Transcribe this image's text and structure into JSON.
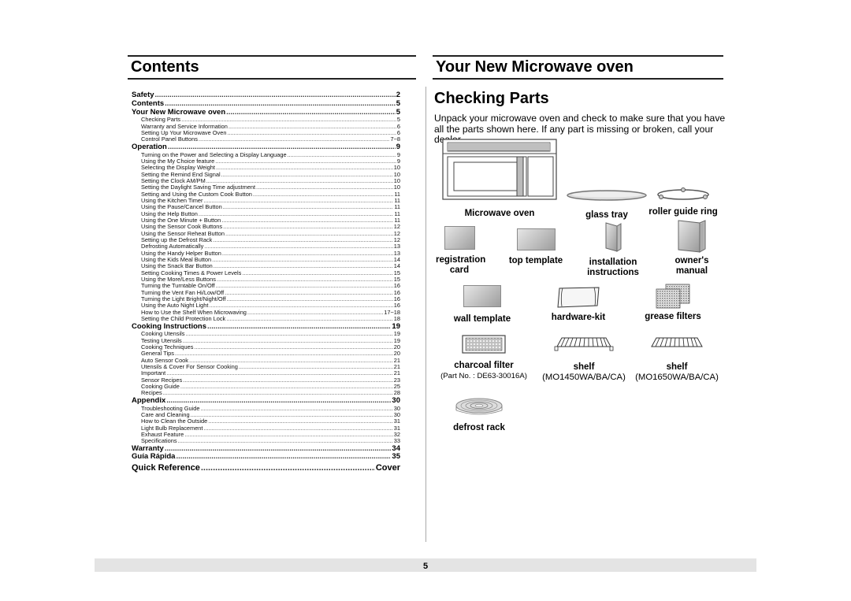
{
  "contents": {
    "title": "Contents",
    "entries": [
      {
        "level": "main",
        "label": "Safety",
        "page": "2"
      },
      {
        "level": "main",
        "label": "Contents",
        "page": "5"
      },
      {
        "level": "main",
        "label": "Your New Microwave oven",
        "page": "5"
      },
      {
        "level": "sub",
        "label": "Checking Parts",
        "page": "5"
      },
      {
        "level": "sub",
        "label": "Warranty and Service Information",
        "page": "6"
      },
      {
        "level": "sub",
        "label": "Setting Up Your Microwave Oven",
        "page": "6"
      },
      {
        "level": "sub",
        "label": "Control Panel Buttons",
        "page": "7~8"
      },
      {
        "level": "main",
        "label": "Operation",
        "page": "9"
      },
      {
        "level": "sub",
        "label": "Turning on the Power and Selecting a Display Language",
        "page": "9"
      },
      {
        "level": "sub",
        "label": "Using the My Choice feature",
        "page": "9"
      },
      {
        "level": "sub",
        "label": "Selecting the Display Weight",
        "page": "10"
      },
      {
        "level": "sub",
        "label": "Setting the Remind End Signal",
        "page": "10"
      },
      {
        "level": "sub",
        "label": "Setting the Clock AM/PM",
        "page": "10"
      },
      {
        "level": "sub",
        "label": "Setting the Daylight Saving Time adjustment",
        "page": "10"
      },
      {
        "level": "sub",
        "label": "Setting and Using the Custom Cook Button",
        "page": "11"
      },
      {
        "level": "sub",
        "label": "Using the Kitchen Timer",
        "page": "11"
      },
      {
        "level": "sub",
        "label": "Using the Pause/Cancel Button",
        "page": "11"
      },
      {
        "level": "sub",
        "label": "Using the Help Button",
        "page": "11"
      },
      {
        "level": "sub",
        "label": "Using the One Minute + Button",
        "page": "11"
      },
      {
        "level": "sub",
        "label": "Using the Sensor Cook Buttons",
        "page": "12"
      },
      {
        "level": "sub",
        "label": "Using the Sensor Reheat Button",
        "page": "12"
      },
      {
        "level": "sub",
        "label": "Setting up the Defrost Rack",
        "page": "12"
      },
      {
        "level": "sub",
        "label": "Defrosting Automatically",
        "page": "13"
      },
      {
        "level": "sub",
        "label": "Using the Handy Helper Button",
        "page": "13"
      },
      {
        "level": "sub",
        "label": "Using the Kids Meal Button",
        "page": "14"
      },
      {
        "level": "sub",
        "label": "Using the Snack Bar Button",
        "page": "14"
      },
      {
        "level": "sub",
        "label": "Setting Cooking Times & Power Levels",
        "page": "15"
      },
      {
        "level": "sub",
        "label": "Using the More/Less Buttons",
        "page": "15"
      },
      {
        "level": "sub",
        "label": "Turning the Turntable On/Off",
        "page": "16"
      },
      {
        "level": "sub",
        "label": "Turning the Vent Fan Hi/Low/Off",
        "page": "16"
      },
      {
        "level": "sub",
        "label": "Turning the  Light Bright/Night/Off",
        "page": "16"
      },
      {
        "level": "sub",
        "label": "Using the Auto Night Light",
        "page": "16"
      },
      {
        "level": "sub",
        "label": "How to Use the Shelf When Microwaving",
        "page": "17~18"
      },
      {
        "level": "sub",
        "label": "Setting the Child Protection Lock",
        "page": "18"
      },
      {
        "level": "main",
        "label": "Cooking Instructions",
        "page": "19"
      },
      {
        "level": "sub",
        "label": "Cooking Utensils",
        "page": "19"
      },
      {
        "level": "sub",
        "label": "Testing Utensils",
        "page": "19"
      },
      {
        "level": "sub",
        "label": "Cooking Techniques",
        "page": "20"
      },
      {
        "level": "sub",
        "label": "General Tips",
        "page": "20"
      },
      {
        "level": "sub",
        "label": "Auto Sensor Cook",
        "page": "21"
      },
      {
        "level": "sub",
        "label": "Utensils & Cover For Sensor Cooking",
        "page": "21"
      },
      {
        "level": "sub",
        "label": "Important",
        "page": "21"
      },
      {
        "level": "sub",
        "label": "Sensor Recipes",
        "page": "23"
      },
      {
        "level": "sub",
        "label": "Cooking Guide",
        "page": "25"
      },
      {
        "level": "sub",
        "label": "Recipes",
        "page": "28"
      },
      {
        "level": "main",
        "label": "Appendix",
        "page": "30"
      },
      {
        "level": "sub",
        "label": "Troubleshooting Guide",
        "page": "30"
      },
      {
        "level": "sub",
        "label": "Care and Cleaning",
        "page": "30"
      },
      {
        "level": "sub",
        "label": "How to Clean the Outside",
        "page": "31"
      },
      {
        "level": "sub",
        "label": "Light Bulb Replacement",
        "page": "31"
      },
      {
        "level": "sub",
        "label": "Exhaust Feature",
        "page": "32"
      },
      {
        "level": "sub",
        "label": "Specifications",
        "page": "33"
      },
      {
        "level": "main",
        "label": "Warranty",
        "page": "34"
      },
      {
        "level": "main",
        "label": "Guía Rápida",
        "page": "35"
      },
      {
        "level": "big",
        "label": "Quick Reference",
        "page": "Cover"
      }
    ]
  },
  "microwave": {
    "title": "Your New Microwave oven",
    "section_title": "Checking Parts",
    "intro": "Unpack your microwave oven and check to make sure that you have all the parts shown here. If any part is missing or broken, call your dealer.",
    "parts": {
      "microwave_oven": {
        "name": "Microwave oven",
        "icon": "microwave-oven-icon"
      },
      "glass_tray": {
        "name": "glass tray",
        "icon": "glass-tray-icon"
      },
      "roller_guide_ring": {
        "name": "roller guide ring",
        "icon": "roller-ring-icon"
      },
      "registration_card": {
        "name": "registration card",
        "icon": "card-icon"
      },
      "top_template": {
        "name": "top template",
        "icon": "template-icon"
      },
      "installation_instructions": {
        "name": "installation instructions",
        "icon": "booklet-icon"
      },
      "owners_manual": {
        "name": "owner's manual",
        "icon": "manual-icon"
      },
      "wall_template": {
        "name": "wall template",
        "icon": "template-icon"
      },
      "hardware_kit": {
        "name": "hardware-kit",
        "icon": "bag-icon"
      },
      "grease_filters": {
        "name": "grease filters",
        "icon": "mesh-filter-icon"
      },
      "charcoal_filter": {
        "name": "charcoal filter",
        "note": "(Part No. : DE63-30016A)",
        "icon": "charcoal-filter-icon"
      },
      "shelf_1450": {
        "name": "shelf",
        "note": "(MO1450WA/BA/CA)",
        "icon": "shelf-icon"
      },
      "shelf_1650": {
        "name": "shelf",
        "note": "(MO1650WA/BA/CA)",
        "icon": "shelf-icon"
      },
      "defrost_rack": {
        "name": "defrost rack",
        "icon": "defrost-rack-icon"
      }
    }
  },
  "footer": {
    "page_number": "5"
  }
}
